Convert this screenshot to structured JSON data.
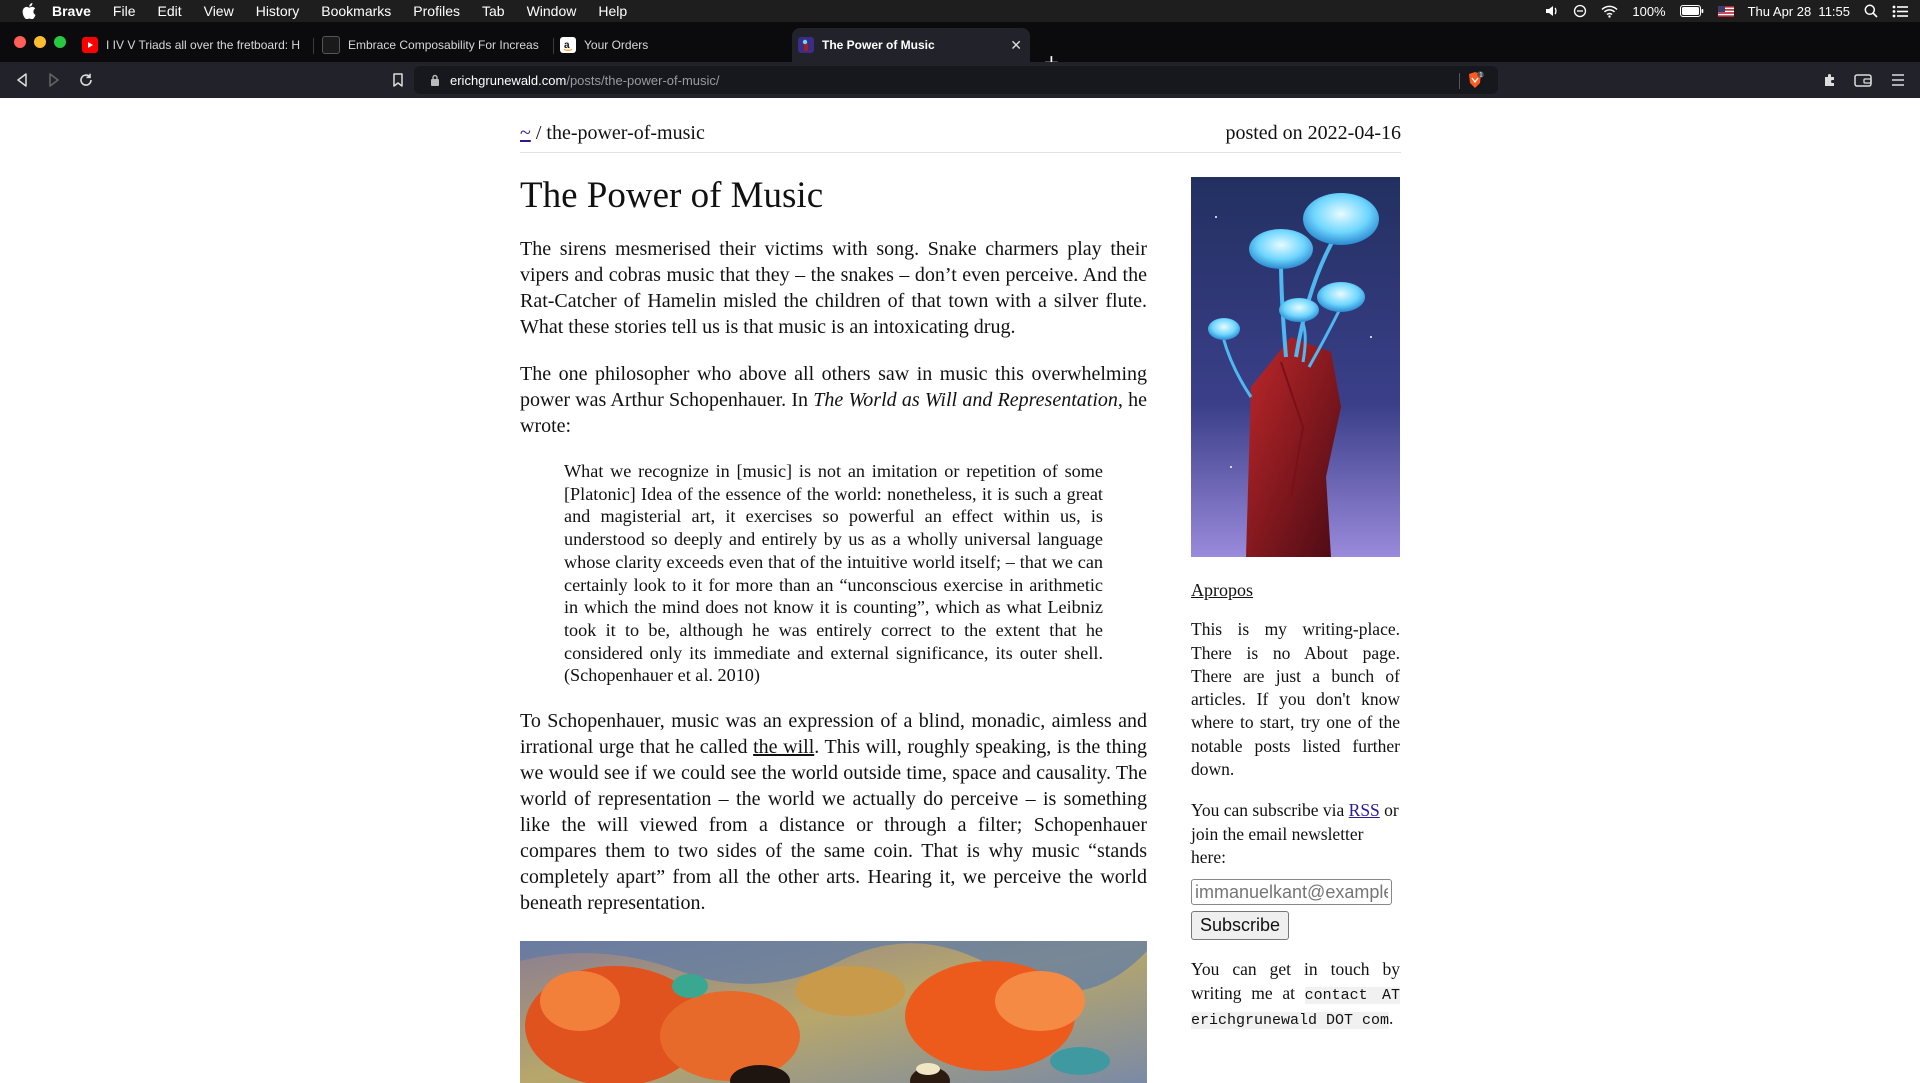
{
  "menubar": {
    "app_name": "Brave",
    "items": [
      "File",
      "Edit",
      "View",
      "History",
      "Bookmarks",
      "Profiles",
      "Tab",
      "Window",
      "Help"
    ],
    "battery": "100%",
    "datetime": "Thu Apr 28  11:55"
  },
  "tabs": [
    {
      "title": "I IV V Triads all over the fretboard: H",
      "favicon": "youtube-icon",
      "active": false
    },
    {
      "title": "Embrace Composability For Increas",
      "favicon": "blog-icon",
      "active": false
    },
    {
      "title": "Your Orders",
      "favicon": "amazon-icon",
      "active": false
    },
    {
      "title": "The Power of Music",
      "favicon": "site-icon",
      "active": true
    }
  ],
  "toolbar": {
    "url_host": "erichgrunewald.com",
    "url_path": "/posts/the-power-of-music/",
    "shield_count": "1"
  },
  "page": {
    "breadcrumb_home": "~",
    "breadcrumb_sep": " / ",
    "breadcrumb_current": "the-power-of-music",
    "posted_on": "posted on 2022-04-16",
    "title": "The Power of Music",
    "p1": "The sirens mesmerised their victims with song. Snake charmers play their vipers and cobras music that they – the snakes – don’t even perceive. And the Rat-Catcher of Hamelin misled the children of that town with a silver flute. What these stories tell us is that music is an intoxicating drug.",
    "p2_before": "The one philosopher who above all others saw in music this overwhelming power was Arthur Schopenhauer. In ",
    "p2_italic": "The World as Will and Representation",
    "p2_after": ", he wrote:",
    "quote": "What we recognize in [music] is not an imitation or repetition of some [Platonic] Idea of the essence of the world: nonetheless, it is such a great and magisterial art, it exercises so powerful an effect within us, is understood so deeply and entirely by us as a wholly universal language whose clarity exceeds even that of the intuitive world itself; – that we can certainly look to it for more than an “un­conscious exercise in arithmetic in which the mind does not know it is counting”, which as what Leibniz took it to be, although he was entirely correct to the extent that he considered only its immediate and external significance, its outer shell. (Schopenhauer et al. 2010)",
    "p3_before": "To Schopenhauer, music was an expression of a blind, monadic, aimless and irrational urge that he called ",
    "p3_link": "the will",
    "p3_after": ". This will, roughly speaking, is the thing we would see if we could see the world outside time, space and causality. The world of representation – the world we actually do perceive – is something like the will viewed from a distance or through a filter; Schopenhauer compares them to two sides of the same coin. That is why music “stands completely apart” from all the other arts. Hearing it, we per­ceive the world beneath representation."
  },
  "sidebar": {
    "heading": "Apropos",
    "about": "This is my writing-place. There is no About page. There are just a bunch of articles. If you don't know where to start, try one of the notable posts listed fur­ther down.",
    "subscribe_before": "You can subscribe via ",
    "rss_link": "RSS",
    "subscribe_after": " or join the email newsletter here:",
    "email_placeholder": "immanuelkant@example.com",
    "subscribe_button": "Subscribe",
    "contact_before": "You can get in touch by writing me at ",
    "contact_code": "contact AT erichgrunewald DOT com",
    "contact_after": "."
  },
  "colors": {
    "link": "#2a1a9a",
    "tab_active": "#22232a",
    "tabstrip": "#0b0b0e"
  }
}
